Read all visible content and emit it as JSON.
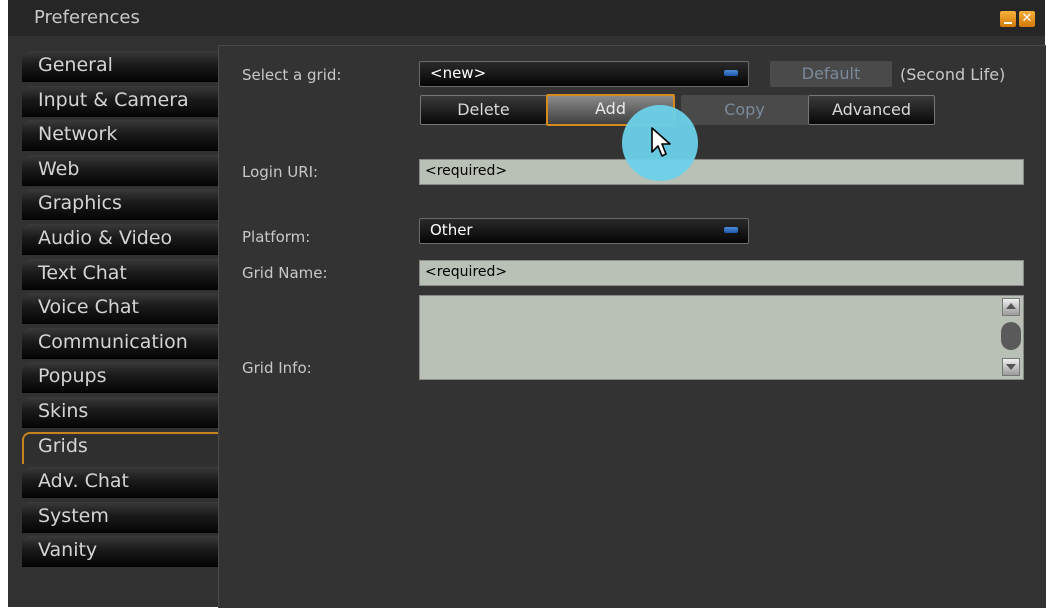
{
  "window": {
    "title": "Preferences",
    "close_glyph": "✕",
    "accent_color": "#d68a1e"
  },
  "sidebar": {
    "items": [
      {
        "label": "General"
      },
      {
        "label": "Input & Camera"
      },
      {
        "label": "Network"
      },
      {
        "label": "Web"
      },
      {
        "label": "Graphics"
      },
      {
        "label": "Audio & Video"
      },
      {
        "label": "Text Chat"
      },
      {
        "label": "Voice Chat"
      },
      {
        "label": "Communication"
      },
      {
        "label": "Popups"
      },
      {
        "label": "Skins"
      },
      {
        "label": "Grids",
        "active": true
      },
      {
        "label": "Adv. Chat"
      },
      {
        "label": "System"
      },
      {
        "label": "Vanity"
      }
    ]
  },
  "grids": {
    "select_label": "Select a grid:",
    "select_value": "<new>",
    "default_button": "Default",
    "default_grid_note": "(Second Life)",
    "buttons": {
      "delete": "Delete",
      "add": "Add",
      "copy": "Copy",
      "advanced": "Advanced"
    },
    "login_uri_label": "Login URI:",
    "login_uri_value": "<required>",
    "platform_label": "Platform:",
    "platform_value": "Other",
    "grid_name_label": "Grid Name:",
    "grid_name_value": "<required>",
    "grid_info_label": "Grid Info:",
    "grid_info_value": ""
  },
  "icons": {
    "cursor": "arrow-cursor-icon",
    "minimize": "minimize-icon",
    "close": "close-icon"
  }
}
